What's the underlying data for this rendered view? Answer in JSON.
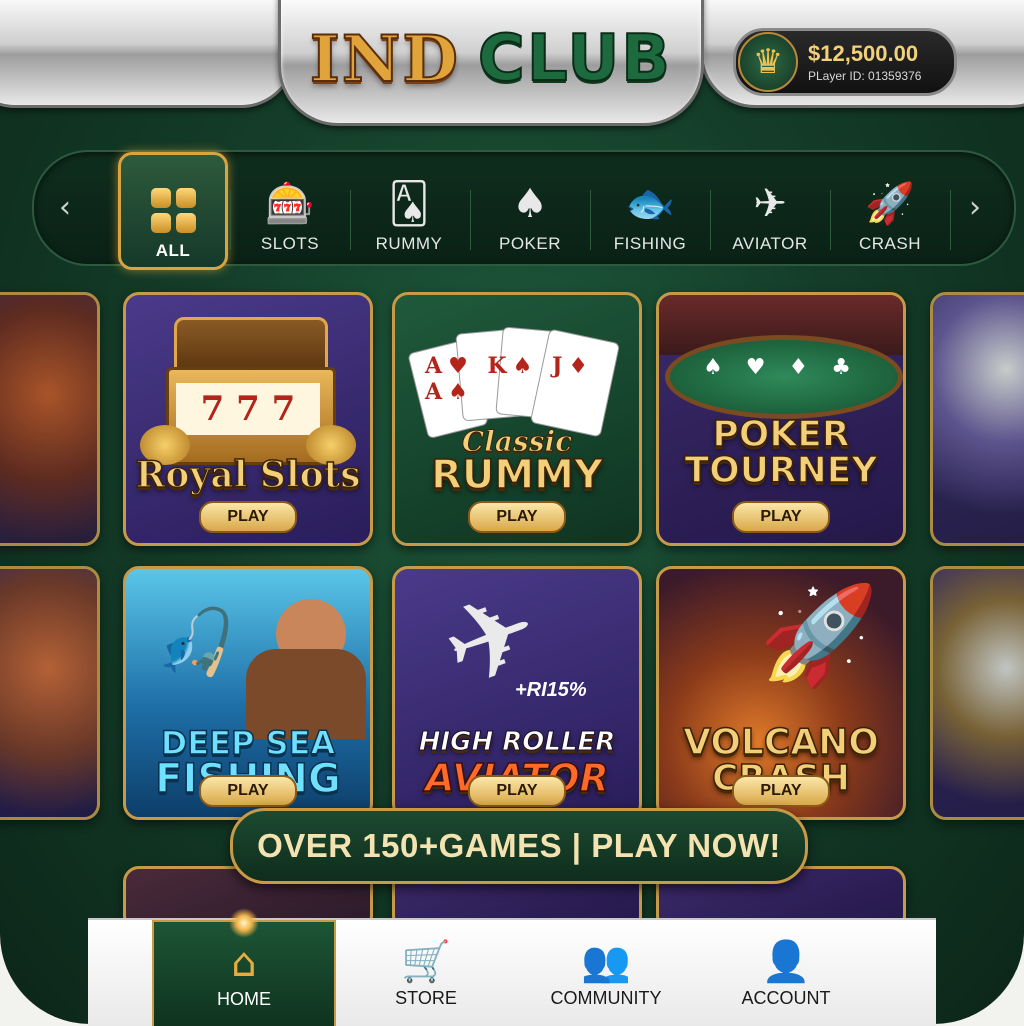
{
  "header": {
    "logo_part1": "IND",
    "logo_part2": "CLUB",
    "balance": "$12,500.00",
    "player_id": "PLayer ID: 01359376",
    "crown_icon": "♛"
  },
  "categories": {
    "prev_icon": "‹",
    "next_icon": "›",
    "items": [
      {
        "label": "ALL",
        "icon": "grid-icon",
        "glyph": ""
      },
      {
        "label": "SLOTS",
        "icon": "slot-machine-icon",
        "glyph": "🎰"
      },
      {
        "label": "RUMMY",
        "icon": "cards-icon",
        "glyph": "🂡"
      },
      {
        "label": "POKER",
        "icon": "poker-cards-icon",
        "glyph": "♠"
      },
      {
        "label": "FISHING",
        "icon": "fish-icon",
        "glyph": "🐟"
      },
      {
        "label": "AVIATOR",
        "icon": "airplane-icon",
        "glyph": "✈"
      },
      {
        "label": "CRASH",
        "icon": "rocket-icon",
        "glyph": "🚀"
      }
    ]
  },
  "games": [
    {
      "title": "Royal Slots",
      "subtitle": "",
      "play": "PLAY",
      "art_glyph": "7 7 7"
    },
    {
      "title": "RUMMY",
      "subtitle": "Classic",
      "play": "PLAY",
      "art_glyph": "A♥ K♠ J♦ A♠"
    },
    {
      "title_line1": "POKER",
      "title_line2": "TOURNEY",
      "play": "PLAY",
      "art_glyph": "♠ ♥ ♦ ♣"
    },
    {
      "title_line1": "DEEP SEA",
      "title_line2": "FISHING",
      "play": "PLAY",
      "art_glyph": "🎣"
    },
    {
      "title_line1": "HIGH ROLLER",
      "title_line2": "AVIATOR",
      "play": "PLAY",
      "art_glyph": "✈",
      "multiplier": "+RI15%"
    },
    {
      "title_line1": "VOLCANO",
      "title_line2": "CRASH",
      "play": "PLAY",
      "art_glyph": "🚀"
    }
  ],
  "banner": {
    "text": "OVER 150+GAMES | PLAY NOW!"
  },
  "nav": {
    "items": [
      {
        "label": "HOME",
        "glyph": "⌂"
      },
      {
        "label": "STORE",
        "glyph": "🛒"
      },
      {
        "label": "COMMUNITY",
        "glyph": "👥"
      },
      {
        "label": "ACCOUNT",
        "glyph": "👤"
      }
    ]
  },
  "colors": {
    "felt_green": "#1f5a3c",
    "gold": "#c99a45",
    "purple_card": "#3b2a6a"
  }
}
